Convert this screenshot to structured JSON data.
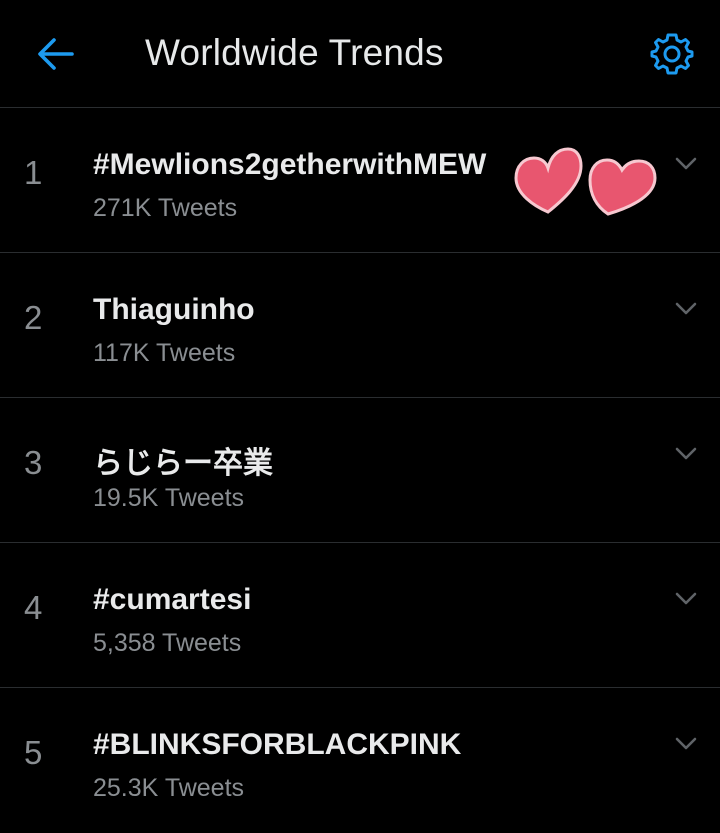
{
  "header": {
    "title": "Worldwide Trends",
    "back_icon": "arrow-left-icon",
    "settings_icon": "gear-icon",
    "accent_color": "#1d9bf0"
  },
  "trends": [
    {
      "rank": "1",
      "name": "#Mewlions2getherwithMEW",
      "count": "271K Tweets"
    },
    {
      "rank": "2",
      "name": "Thiaguinho",
      "count": "117K Tweets"
    },
    {
      "rank": "3",
      "name": "らじらー卒業",
      "count": "19.5K Tweets"
    },
    {
      "rank": "4",
      "name": "#cumartesi",
      "count": "5,358 Tweets"
    },
    {
      "rank": "5",
      "name": "#BLINKSFORBLACKPINK",
      "count": "25.3K Tweets"
    }
  ],
  "decorations": {
    "hearts_icon": "heart-sticker-icon",
    "heart_color": "#e8566f"
  },
  "colors": {
    "background": "#000000",
    "primary_text": "#e7e9ea",
    "secondary_text": "#8a8e92",
    "divider": "#2a2d30"
  }
}
